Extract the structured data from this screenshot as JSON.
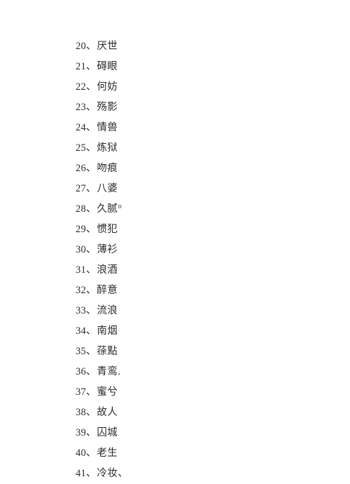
{
  "document": {
    "background_color": "#ffffff",
    "text_color": "#2c2c2c",
    "separator": "、",
    "entries": [
      {
        "index": "20",
        "text": "厌世"
      },
      {
        "index": "21",
        "text": "碍眼"
      },
      {
        "index": "22",
        "text": "何妨"
      },
      {
        "index": "23",
        "text": "殇影"
      },
      {
        "index": "24",
        "text": "情兽"
      },
      {
        "index": "25",
        "text": "炼狱"
      },
      {
        "index": "26",
        "text": "吻痕"
      },
      {
        "index": "27",
        "text": "八婆"
      },
      {
        "index": "28",
        "text": "久腻°"
      },
      {
        "index": "29",
        "text": "惯犯"
      },
      {
        "index": "30",
        "text": "薄衫"
      },
      {
        "index": "31",
        "text": "浪酒"
      },
      {
        "index": "32",
        "text": "醉意"
      },
      {
        "index": "33",
        "text": "流浪"
      },
      {
        "index": "34",
        "text": "南烟"
      },
      {
        "index": "35",
        "text": "蒣點"
      },
      {
        "index": "36",
        "text": "青鸾."
      },
      {
        "index": "37",
        "text": "蜜兮"
      },
      {
        "index": "38",
        "text": "故人"
      },
      {
        "index": "39",
        "text": "囚城"
      },
      {
        "index": "40",
        "text": "老生"
      },
      {
        "index": "41",
        "text": "冷妆、"
      }
    ]
  }
}
